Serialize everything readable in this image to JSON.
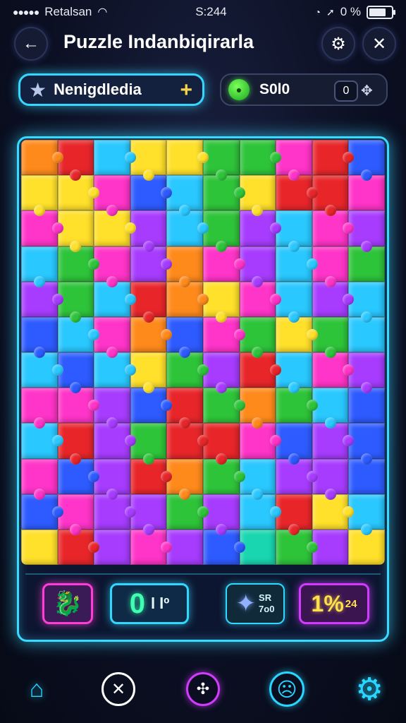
{
  "status_bar": {
    "signal_dots": "●●●●●",
    "carrier": "Retalsan",
    "wifi_icon": "wifi-icon",
    "time": "S:244",
    "right_text": "0 %",
    "battery_level": 0.9
  },
  "header": {
    "title": "Puzzle Indanbiqirarla",
    "back_glyph": "←",
    "settings_glyph": "⚙",
    "close_glyph": "✕"
  },
  "info": {
    "left_label": "Nenigdledia",
    "left_plus": "+",
    "coins": "S0l0",
    "counter": "0",
    "move_glyph": "✥"
  },
  "board": {
    "columns": 10,
    "rows": 12,
    "palette": {
      "R": "#e8262a",
      "O": "#ff8a1c",
      "Y": "#ffe02a",
      "G": "#2ec43a",
      "C": "#29c8ff",
      "B": "#2d5bff",
      "P": "#a73cff",
      "M": "#ff34c8",
      "L": "#7be23a",
      "T": "#19d6b0"
    },
    "pieces": [
      "ORCYYGGMRB",
      "YYMBCGYRRM",
      "MYYPCGPCMP",
      "CGMPOMPCMG",
      "PGCROYMCPC",
      "BCMOBMGYGC",
      "CBCYGPRCMP",
      "MMPBRGOGCB",
      "CRPGRRMBPB",
      "MBPROGCPPB",
      "BMPPGPCRYC",
      "YRPMPBTGPY"
    ]
  },
  "bottom_bar": {
    "character_glyph": "🐉",
    "score_big": "0",
    "score_small": "l lº",
    "star_glyph": "✦",
    "star_line1": "SR",
    "star_line2": "7o0",
    "percent_big": "1%",
    "percent_small": "24"
  },
  "nav": {
    "home_glyph": "⌂",
    "tools_glyph": "✕",
    "puzzle_glyph": "✣",
    "face_glyph": "☹",
    "settings_glyph": "⚙"
  }
}
